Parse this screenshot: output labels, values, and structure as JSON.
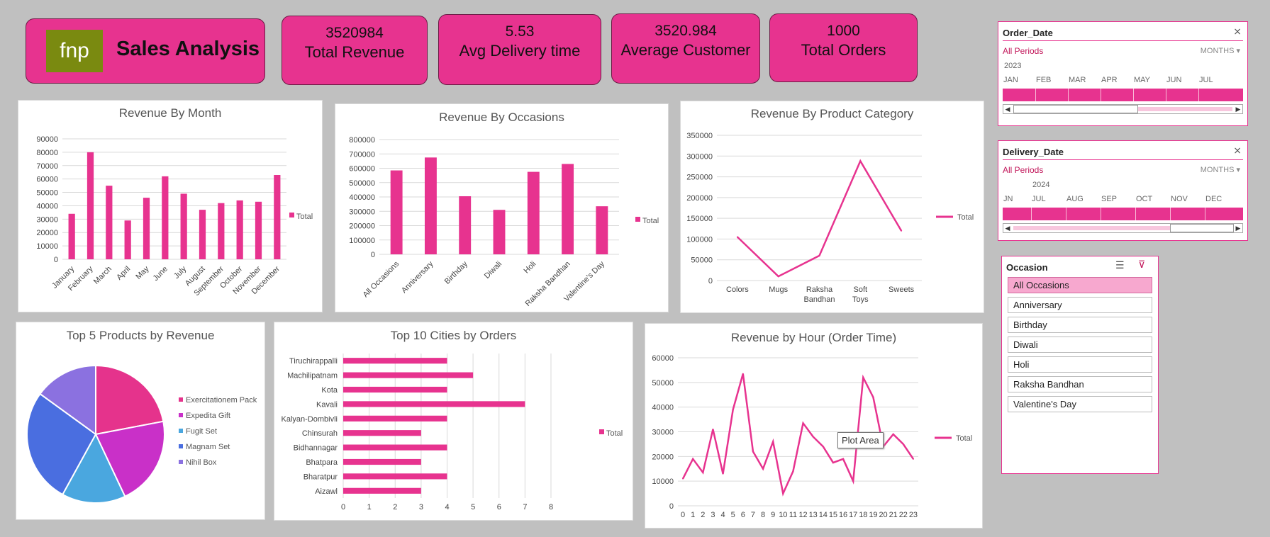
{
  "header": {
    "logo_text": "fnp",
    "title": "Sales Analysis"
  },
  "kpis": [
    {
      "value": "3520984",
      "label": "Total Revenue"
    },
    {
      "value": "5.53",
      "label": "Avg Delivery time"
    },
    {
      "value": "3520.984",
      "label": "Average Customer"
    },
    {
      "value": "1000",
      "label": "Total Orders"
    }
  ],
  "slicers": {
    "order_date": {
      "title": "Order_Date",
      "all_periods": "All Periods",
      "granularity": "MONTHS",
      "year": "2023",
      "months": [
        "JAN",
        "FEB",
        "MAR",
        "APR",
        "MAY",
        "JUN",
        "JUL"
      ]
    },
    "delivery_date": {
      "title": "Delivery_Date",
      "all_periods": "All Periods",
      "granularity": "MONTHS",
      "year": "2024",
      "months": [
        "JN",
        "JUL",
        "AUG",
        "SEP",
        "OCT",
        "NOV",
        "DEC"
      ]
    },
    "occasion": {
      "title": "Occasion",
      "items": [
        "All Occasions",
        "Anniversary",
        "Birthday",
        "Diwali",
        "Holi",
        "Raksha Bandhan",
        "Valentine's Day"
      ],
      "selected": "All Occasions"
    }
  },
  "tooltip": "Plot Area",
  "colors": {
    "accent": "#e7338f",
    "pie": [
      "#e5338c",
      "#c930c8",
      "#4aa7df",
      "#4a6ee0",
      "#8b71e0"
    ]
  },
  "chart_data": [
    {
      "id": "rev_month",
      "type": "bar",
      "title": "Revenue By Month",
      "categories": [
        "January",
        "February",
        "March",
        "April",
        "May",
        "June",
        "July",
        "August",
        "September",
        "October",
        "November",
        "December"
      ],
      "series": [
        {
          "name": "Total",
          "values": [
            34000,
            80000,
            55000,
            29000,
            46000,
            62000,
            49000,
            37000,
            42000,
            44000,
            43000,
            63000
          ]
        }
      ],
      "yticks": [
        "0",
        "10000",
        "20000",
        "30000",
        "40000",
        "50000",
        "60000",
        "70000",
        "80000",
        "90000"
      ],
      "ylim": [
        0,
        90000
      ],
      "legend": "right",
      "grid": true
    },
    {
      "id": "rev_occasion",
      "type": "bar",
      "title": "Revenue By Occasions",
      "categories": [
        "All Occasions",
        "Anniversary",
        "Birthday",
        "Diwali",
        "Holi",
        "Raksha Bandhan",
        "Valentine's Day"
      ],
      "series": [
        {
          "name": "Total",
          "values": [
            585000,
            675000,
            405000,
            310000,
            575000,
            630000,
            335000
          ]
        }
      ],
      "yticks": [
        "0",
        "100000",
        "200000",
        "300000",
        "400000",
        "500000",
        "600000",
        "700000",
        "800000"
      ],
      "ylim": [
        0,
        800000
      ],
      "legend": "right",
      "grid": true
    },
    {
      "id": "rev_category",
      "type": "line",
      "title": "Revenue By Product Category",
      "categories": [
        "Colors",
        "Mugs",
        "Raksha Bandhan",
        "Soft Toys",
        "Sweets"
      ],
      "series": [
        {
          "name": "Total",
          "values": [
            105000,
            10000,
            60000,
            288000,
            120000
          ]
        }
      ],
      "yticks": [
        "0",
        "50000",
        "100000",
        "150000",
        "200000",
        "250000",
        "300000",
        "350000"
      ],
      "ylim": [
        0,
        350000
      ],
      "legend": "right",
      "grid": true
    },
    {
      "id": "top5_products",
      "type": "pie",
      "title": "Top 5 Products by Revenue",
      "labels": [
        "Exercitationem Pack",
        "Expedita Gift",
        "Fugit Set",
        "Magnam Set",
        "Nihil Box"
      ],
      "values": [
        22,
        21,
        15,
        27,
        15
      ],
      "legend": "right"
    },
    {
      "id": "top10_cities",
      "type": "bar",
      "orientation": "horizontal",
      "title": "Top 10 Cities by Orders",
      "categories": [
        "Tiruchirappalli",
        "Machilipatnam",
        "Kota",
        "Kavali",
        "Kalyan-Dombivli",
        "Chinsurah",
        "Bidhannagar",
        "Bhatpara",
        "Bharatpur",
        "Aizawl"
      ],
      "series": [
        {
          "name": "Total",
          "values": [
            4,
            5,
            4,
            7,
            4,
            3,
            4,
            3,
            4,
            3
          ]
        }
      ],
      "xticks": [
        "0",
        "1",
        "2",
        "3",
        "4",
        "5",
        "6",
        "7",
        "8"
      ],
      "xlim": [
        0,
        8
      ],
      "legend": "right",
      "grid": true
    },
    {
      "id": "rev_hour",
      "type": "line",
      "title": "Revenue by Hour (Order Time)",
      "categories": [
        "0",
        "1",
        "2",
        "3",
        "4",
        "5",
        "6",
        "7",
        "8",
        "9",
        "10",
        "11",
        "12",
        "13",
        "14",
        "15",
        "16",
        "17",
        "18",
        "19",
        "20",
        "21",
        "22",
        "23"
      ],
      "series": [
        {
          "name": "Total",
          "values": [
            11000,
            19000,
            13500,
            31000,
            13000,
            39000,
            53500,
            22000,
            15000,
            26000,
            5000,
            14000,
            33500,
            28000,
            24000,
            17500,
            19000,
            10000,
            52000,
            44000,
            24000,
            29000,
            25000,
            19000
          ]
        }
      ],
      "yticks": [
        "0",
        "10000",
        "20000",
        "30000",
        "40000",
        "50000",
        "60000"
      ],
      "ylim": [
        0,
        60000
      ],
      "legend": "right",
      "grid": true
    }
  ]
}
